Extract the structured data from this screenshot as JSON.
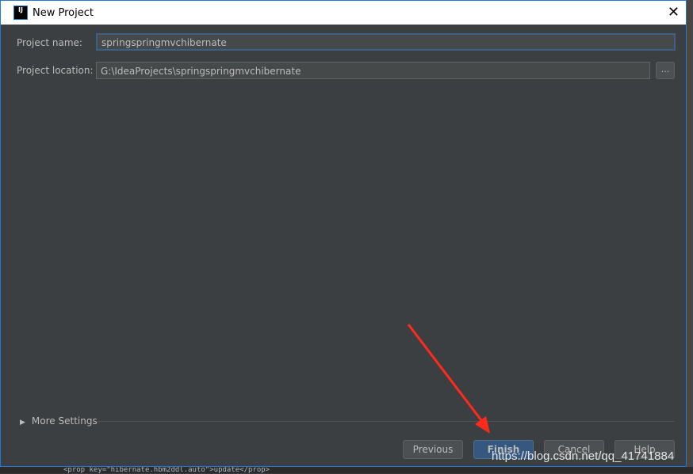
{
  "window": {
    "title": "New Project",
    "close_icon": "close-icon"
  },
  "form": {
    "name_label": "Project name:",
    "name_value": "springspringmvchibernate",
    "location_label": "Project location:",
    "location_value": "G:\\IdeaProjects\\springspringmvchibernate",
    "browse_label": "..."
  },
  "more_settings": "More Settings",
  "buttons": {
    "previous": "Previous",
    "finish": "Finish",
    "cancel": "Cancel",
    "help": "Help"
  },
  "background_code": "<prop key=\"hibernate.hbm2ddl.auto\">update</prop>",
  "watermark": "https://blog.csdn.net/qq_41741884",
  "colors": {
    "accent": "#365880",
    "annotation_arrow": "#ff2a1a"
  }
}
